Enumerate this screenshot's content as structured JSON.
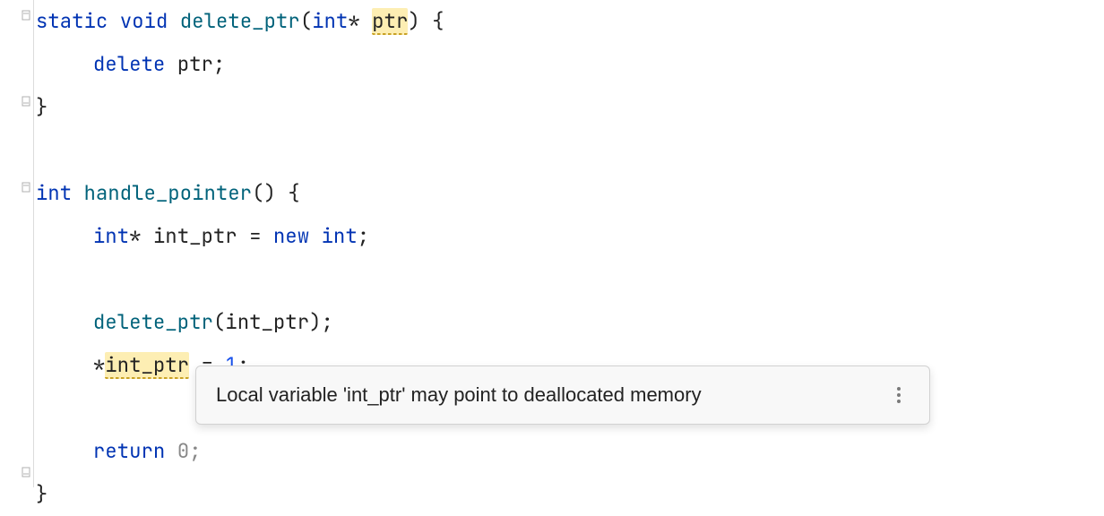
{
  "code": {
    "line1": {
      "kw1": "static",
      "kw2": "void",
      "fn": "delete_ptr",
      "paren_open": "(",
      "type": "int",
      "star": "*",
      "space": " ",
      "param": "ptr",
      "rest": ") {"
    },
    "line2": {
      "kw": "delete",
      "space": " ",
      "var": "ptr",
      "semi": ";"
    },
    "line3": {
      "brace": "}"
    },
    "line5": {
      "type": "int",
      "space": " ",
      "fn": "handle_pointer",
      "rest": "() {"
    },
    "line6": {
      "type": "int",
      "star": "*",
      "space1": " ",
      "var": "int_ptr",
      "eq": " = ",
      "kw": "new",
      "space2": " ",
      "type2": "int",
      "semi": ";"
    },
    "line8": {
      "fn": "delete_ptr",
      "open": "(",
      "arg": "int_ptr",
      "rest": ");"
    },
    "line9": {
      "star": "*",
      "var": "int_ptr",
      "eq": " = ",
      "num": "1",
      "semi": ";"
    },
    "line11": {
      "kw": "return",
      "space": " ",
      "obscured": "0;"
    },
    "line12": {
      "brace": "}"
    }
  },
  "tooltip": {
    "message": "Local variable 'int_ptr' may point to deallocated memory"
  },
  "icons": {
    "fold_open": "fold-open-icon",
    "fold_close": "fold-close-icon",
    "more": "more-vertical-icon"
  }
}
